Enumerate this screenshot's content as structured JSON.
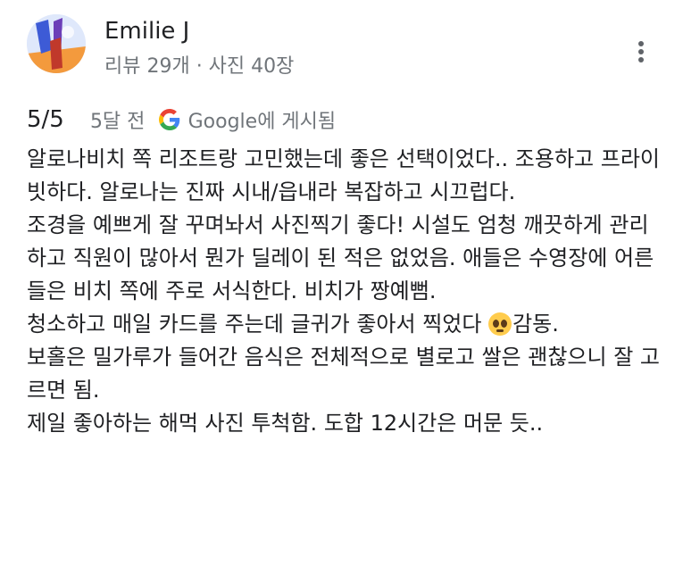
{
  "reviewer": {
    "name": "Emilie J",
    "stats": "리뷰 29개 · 사진 40장",
    "avatar_icon": "profile-photo-avatar"
  },
  "menu": {
    "icon": "more-vert-icon"
  },
  "review": {
    "rating": "5/5",
    "time_ago": "5달 전",
    "source_icon": "google-g-icon",
    "source_text": "Google에 게시됨",
    "paragraphs": [
      "알로나비치 쪽 리조트랑 고민했는데 좋은 선택이었다.. 조용하고 프라이빗하다. 알로나는 진짜 시내/읍내라 복잡하고 시끄럽다.",
      "조경을 예쁘게 잘 꾸며놔서 사진찍기 좋다! 시설도 엄청 깨끗하게 관리하고 직원이 많아서 뭔가 딜레이 된 적은 없었음. 애들은 수영장에 어른들은 비치 쪽에 주로 서식한다. 비치가 짱예뻠.",
      "청소하고 매일 카드를 주는데 글귀가 좋아서 찍었다",
      "감동.",
      "보홀은 밀가루가 들어간 음식은 전체적으로 별로고 쌀은 괜찮으니 잘 고르면 됨.",
      "제일 좋아하는 해먹 사진 투척함. 도합 12시간은 머문 듯.."
    ],
    "emoji_icon": "pleading-face-emoji"
  }
}
